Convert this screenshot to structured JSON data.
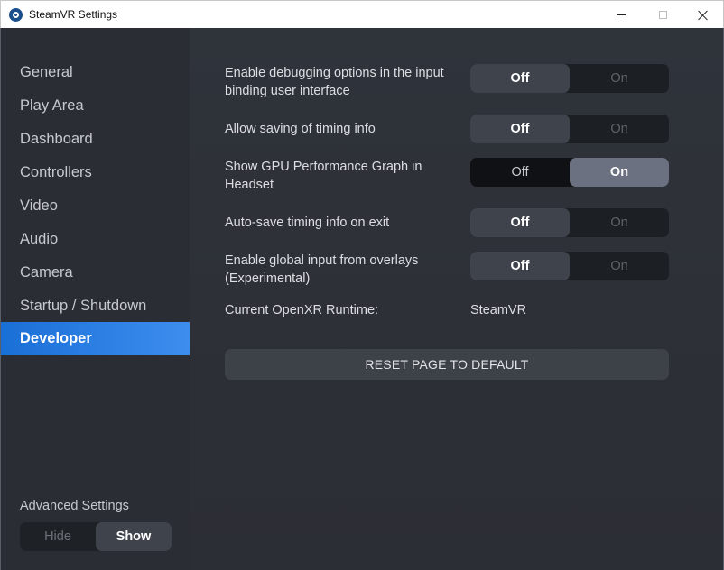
{
  "window": {
    "title": "SteamVR Settings",
    "icon": "steamvr-logo-icon",
    "controls": [
      "minimize-icon",
      "maximize-icon",
      "close-icon"
    ]
  },
  "sidebar": {
    "items": [
      {
        "label": "General",
        "active": false
      },
      {
        "label": "Play Area",
        "active": false
      },
      {
        "label": "Dashboard",
        "active": false
      },
      {
        "label": "Controllers",
        "active": false
      },
      {
        "label": "Video",
        "active": false
      },
      {
        "label": "Audio",
        "active": false
      },
      {
        "label": "Camera",
        "active": false
      },
      {
        "label": "Startup / Shutdown",
        "active": false
      },
      {
        "label": "Developer",
        "active": true
      }
    ],
    "advanced": {
      "label": "Advanced Settings",
      "options": [
        "Hide",
        "Show"
      ],
      "selected": "Show"
    }
  },
  "settings": [
    {
      "label": "Enable debugging options in the input binding user interface",
      "off": "Off",
      "on": "On",
      "value": "Off"
    },
    {
      "label": "Allow saving of timing info",
      "off": "Off",
      "on": "On",
      "value": "Off"
    },
    {
      "label": "Show GPU Performance Graph in Headset",
      "off": "Off",
      "on": "On",
      "value": "On"
    },
    {
      "label": "Auto-save timing info on exit",
      "off": "Off",
      "on": "On",
      "value": "Off"
    },
    {
      "label": "Enable global input from overlays (Experimental)",
      "off": "Off",
      "on": "On",
      "value": "Off"
    }
  ],
  "runtime": {
    "label": "Current OpenXR Runtime:",
    "value": "SteamVR"
  },
  "reset_label": "RESET PAGE TO DEFAULT",
  "colors": {
    "accent": "#1a6fd6",
    "sidebar_bg": "#2a2d33",
    "main_bg": "#2f333a"
  }
}
